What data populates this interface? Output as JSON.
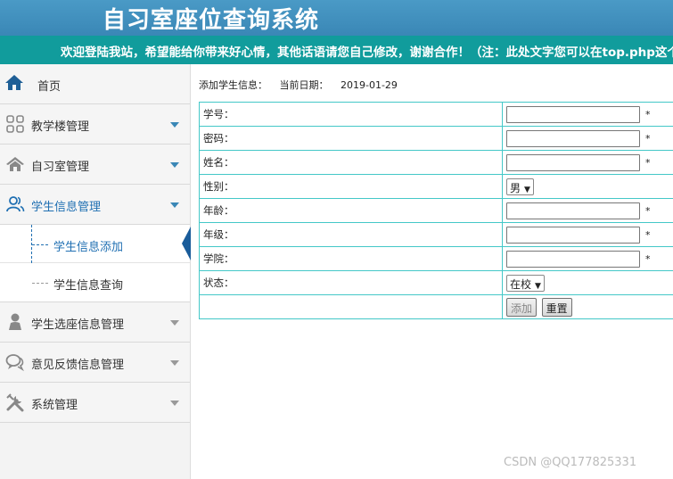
{
  "header": {
    "title": "自习室座位查询系统"
  },
  "marquee": {
    "text": "欢迎登陆我站，希望能给你带来好心情，其他话语请您自己修改，谢谢合作！（注：此处文字您可以在top.php这个文件中修改）"
  },
  "sidebar": {
    "home": "首页",
    "items": [
      {
        "label": "教学楼管理",
        "icon": "grid-icon"
      },
      {
        "label": "自习室管理",
        "icon": "house-icon"
      },
      {
        "label": "学生信息管理",
        "icon": "users-icon"
      },
      {
        "label": "学生选座信息管理",
        "icon": "person-icon"
      },
      {
        "label": "意见反馈信息管理",
        "icon": "chat-icon"
      },
      {
        "label": "系统管理",
        "icon": "tools-icon"
      }
    ],
    "submenu": [
      {
        "label": "学生信息添加"
      },
      {
        "label": "学生信息查询"
      }
    ]
  },
  "main": {
    "heading": "添加学生信息：",
    "date_label": "当前日期：",
    "date_value": "2019-01-29",
    "fields": [
      {
        "label": "学号：",
        "type": "text",
        "value": "",
        "required": "*"
      },
      {
        "label": "密码：",
        "type": "text",
        "value": "",
        "required": "*"
      },
      {
        "label": "姓名：",
        "type": "text",
        "value": "",
        "required": "*"
      },
      {
        "label": "性别：",
        "type": "select",
        "value": "男"
      },
      {
        "label": "年龄：",
        "type": "text",
        "value": "",
        "required": "*"
      },
      {
        "label": "年级：",
        "type": "text",
        "value": "",
        "required": "*"
      },
      {
        "label": "学院：",
        "type": "text",
        "value": "",
        "required": "*"
      },
      {
        "label": "状态：",
        "type": "select",
        "value": "在校"
      }
    ],
    "buttons": {
      "add": "添加",
      "reset": "重置"
    }
  },
  "watermark": "CSDN @QQ177825331",
  "colors": {
    "header": "#3a87b6",
    "marquee": "#119c9c",
    "border": "#44c8c8",
    "accent": "#1f6fb2"
  }
}
